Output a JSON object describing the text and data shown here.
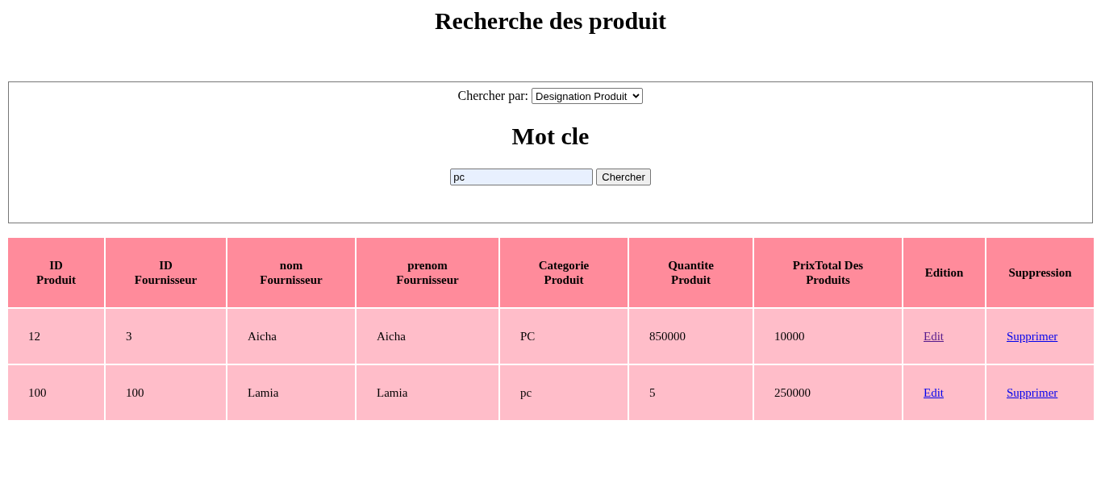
{
  "page": {
    "title": "Recherche des produit"
  },
  "search": {
    "label": "Chercher par:",
    "select_value": "Designation Produit",
    "heading": "Mot cle",
    "input_value": "pc",
    "autofilled": true,
    "button": "Chercher"
  },
  "table": {
    "columns": [
      "ID Produit",
      "ID Fournisseur",
      "nom Fournisseur",
      "prenom Fournisseur",
      "Categorie Produit",
      "Quantite Produit",
      "PrixTotal Des Produits",
      "Edition",
      "Suppression"
    ],
    "rows": [
      {
        "cells": [
          "12",
          "3",
          "Aicha",
          "Aicha",
          "PC",
          "850000",
          "10000"
        ],
        "edit": {
          "label": "Edit",
          "visited": true
        },
        "delete": {
          "label": "Supprimer",
          "visited": false
        }
      },
      {
        "cells": [
          "100",
          "100",
          "Lamia",
          "Lamia",
          "pc",
          "5",
          "250000"
        ],
        "edit": {
          "label": "Edit",
          "visited": false
        },
        "delete": {
          "label": "Supprimer",
          "visited": false
        }
      }
    ]
  }
}
